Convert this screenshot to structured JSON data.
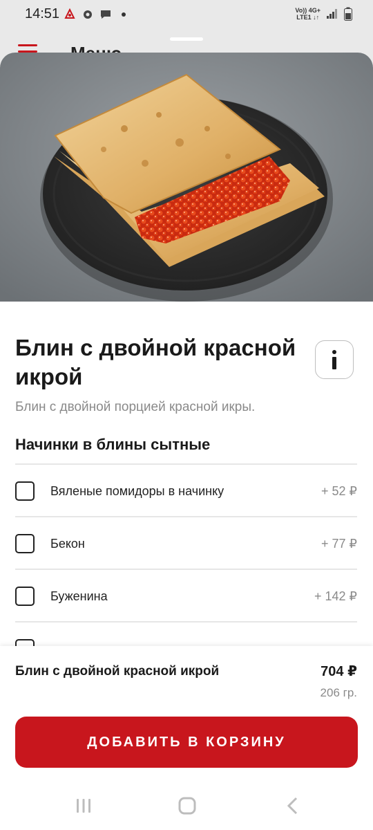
{
  "status_bar": {
    "time": "14:51",
    "network_top": "Vo)) 4G+",
    "network_bottom": "LTE1 ↓↑"
  },
  "background_screen": {
    "title": "Меню"
  },
  "product": {
    "title": "Блин с двойной красной икрой",
    "description": "Блин с двойной порцией красной икры.",
    "info_icon": "info-icon"
  },
  "options_section": {
    "title": "Начинки в блины сытные",
    "items": [
      {
        "label": "Вяленые помидоры в начинку",
        "price": "+ 52 ₽"
      },
      {
        "label": "Бекон",
        "price": "+ 77 ₽"
      },
      {
        "label": "Буженина",
        "price": "+ 142 ₽"
      }
    ]
  },
  "summary": {
    "name": "Блин с двойной красной икрой",
    "price": "704 ₽",
    "weight": "206 гр."
  },
  "cta": {
    "add_to_cart": "ДОБАВИТЬ В КОРЗИНУ"
  },
  "colors": {
    "accent": "#c8161d",
    "muted_text": "#8a8a8a"
  }
}
